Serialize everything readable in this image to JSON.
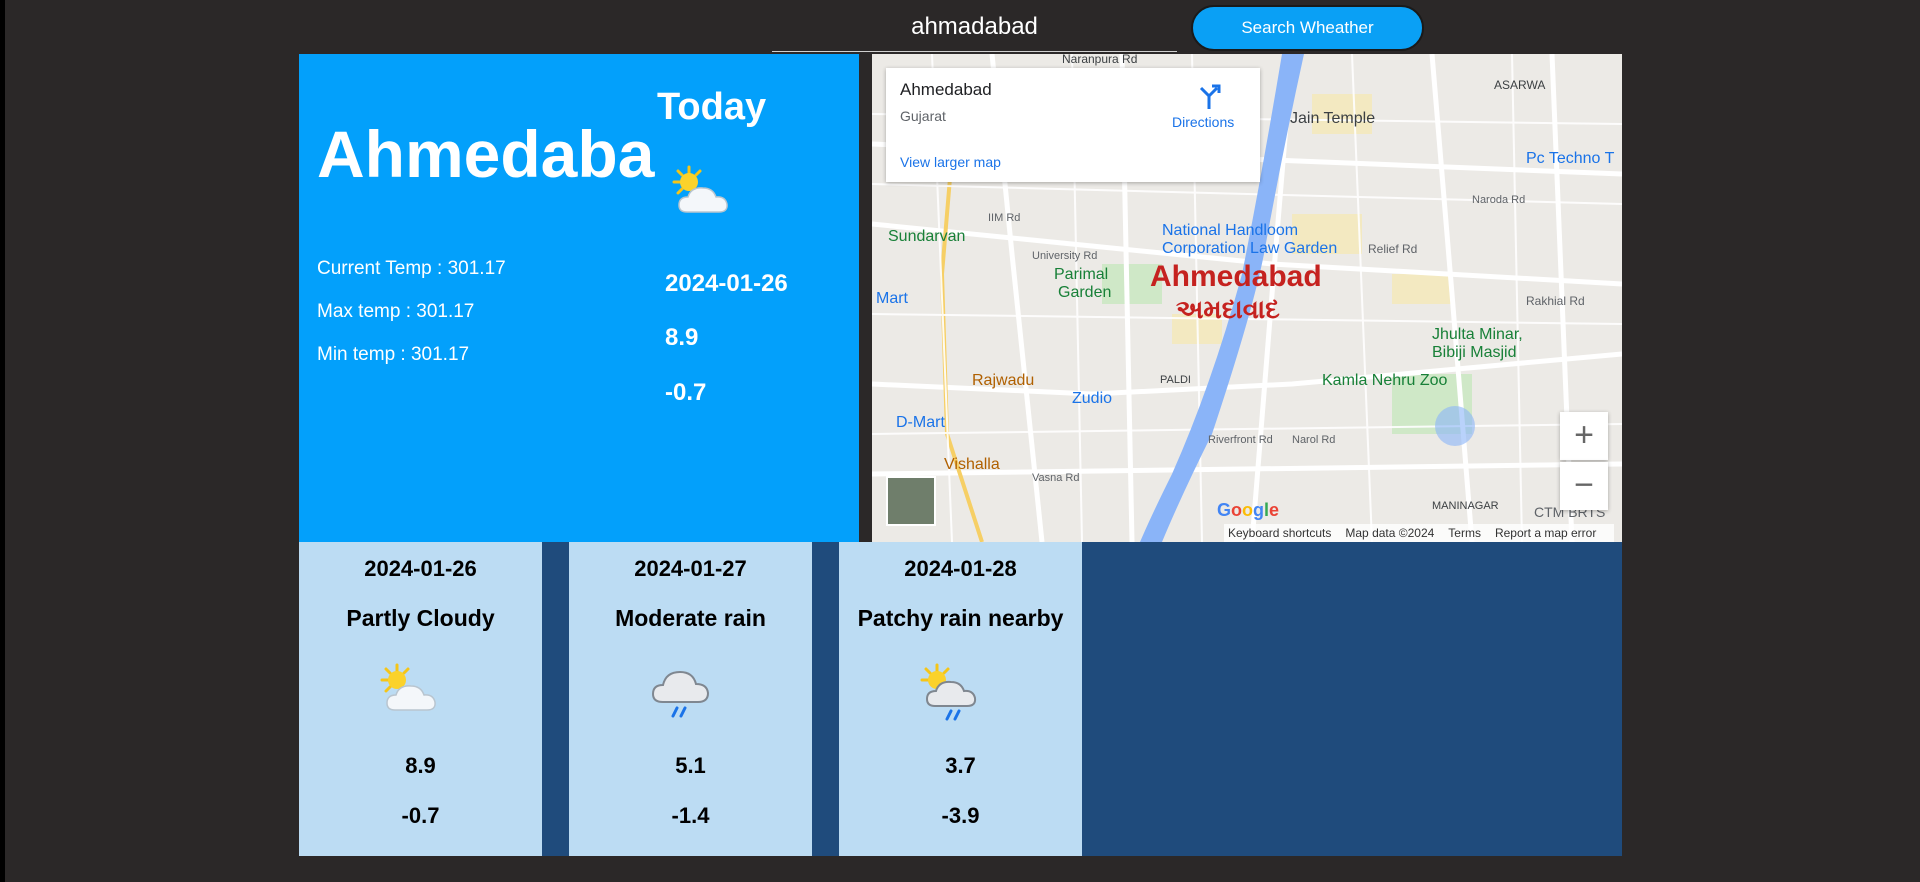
{
  "search": {
    "value": "ahmadabad",
    "button_label": "Search Wheather"
  },
  "current": {
    "city": "Ahmedabad",
    "current_temp_label": "Current Temp : ",
    "current_temp": "301.17",
    "max_temp_label": "Max temp : ",
    "max_temp": "301.17",
    "min_temp_label": "Min temp : ",
    "min_temp": "301.17"
  },
  "today": {
    "title": "Today",
    "icon": "partly-cloudy-icon",
    "date": "2024-01-26",
    "max": "8.9",
    "min": "-0.7"
  },
  "map": {
    "card_title": "Ahmedabad",
    "card_subtitle": "Gujarat",
    "card_link": "View larger map",
    "directions_label": "Directions",
    "city_label_en": "Ahmedabad",
    "city_label_gu": "અમદાવાદ",
    "labels": [
      "Naranpura Rd",
      "ASARWA",
      "Jain Temple",
      "Pc Techno T",
      "National Handloom",
      "Corporation Law Garden",
      "Sundarvan",
      "Parimal",
      "Garden",
      "Mart",
      "Relief Rd",
      "Rakhial Rd",
      "Jhulta Minar,",
      "Bibiji Masjid",
      "Kamla Nehru Zoo",
      "Rajwadu",
      "Zudio",
      "D-Mart",
      "Vishalla",
      "PALDI",
      "MANINAGAR",
      "CTM BRTS",
      "IIM Rd",
      "University Rd",
      "Riverfront Rd",
      "Narol Rd",
      "Vasna Rd",
      "Naroda Rd"
    ],
    "zoom_in": "+",
    "zoom_out": "−",
    "google_logo": "Google",
    "footer": [
      "Keyboard shortcuts",
      "Map data ©2024",
      "Terms",
      "Report a map error"
    ]
  },
  "forecast": [
    {
      "date": "2024-01-26",
      "condition": "Partly Cloudy",
      "icon": "partly-cloudy-icon",
      "max": "8.9",
      "min": "-0.7"
    },
    {
      "date": "2024-01-27",
      "condition": "Moderate rain",
      "icon": "rain-cloud-icon",
      "max": "5.1",
      "min": "-1.4"
    },
    {
      "date": "2024-01-28",
      "condition": "Patchy rain nearby",
      "icon": "patchy-rain-icon",
      "max": "3.7",
      "min": "-3.9"
    }
  ],
  "colors": {
    "background": "#2b2828",
    "panel_blue": "#03a0fb",
    "button_blue": "#0aa0f5",
    "forecast_bg": "#1f4b7c",
    "card_bg": "#bcdcf3",
    "map_city": "#c5221f"
  }
}
